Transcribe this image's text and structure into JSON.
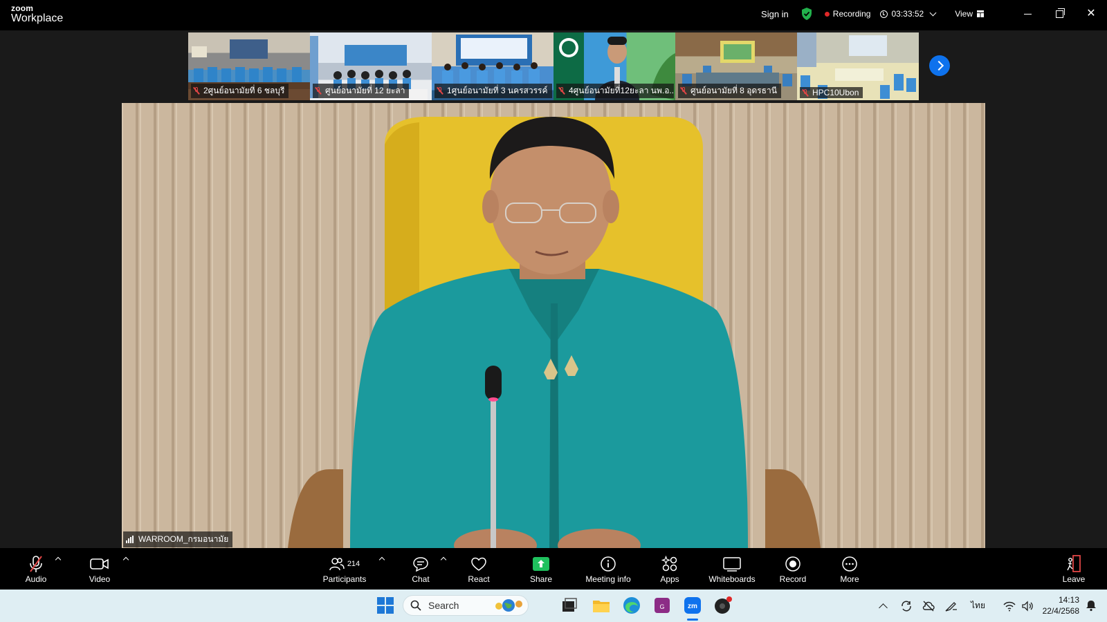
{
  "app": {
    "brand_small": "zoom",
    "brand_large": "Workplace"
  },
  "titlebar": {
    "sign_in": "Sign in",
    "recording": "Recording",
    "elapsed": "03:33:52",
    "view": "View",
    "icons": [
      "shield-check-icon",
      "clock-icon",
      "chevron-down-icon",
      "grid-icon",
      "minimize-icon",
      "restore-icon",
      "close-icon"
    ]
  },
  "thumbnails": [
    {
      "name": "2ศูนย์อนามัยที่ 6 ชลบุรี",
      "muted": true
    },
    {
      "name": "ศูนย์อนามัยที่ 12 ยะลา",
      "muted": true
    },
    {
      "name": "1ศูนย์อนามัยที่ 3 นครสวรรค์",
      "muted": true
    },
    {
      "name": "4ศูนย์อนามัยที่12ยะลา นพ.อ...",
      "muted": true
    },
    {
      "name": "ศูนย์อนามัยที่ 8 อุดรธานี",
      "muted": true
    },
    {
      "name": "HPC10Ubon",
      "muted": true
    }
  ],
  "main_video": {
    "speaker": "WARROOM_กรมอนามัย"
  },
  "toolbar": {
    "audio": "Audio",
    "video": "Video",
    "participants": "Participants",
    "participant_count": "214",
    "chat": "Chat",
    "react": "React",
    "share": "Share",
    "meeting_info": "Meeting info",
    "apps": "Apps",
    "whiteboards": "Whiteboards",
    "record": "Record",
    "more": "More",
    "leave": "Leave"
  },
  "taskbar": {
    "search_placeholder": "Search",
    "language": "ไทย",
    "time": "14:13",
    "date": "22/4/2568"
  },
  "colors": {
    "accent": "#0e72ed",
    "share_green": "#1fc15e",
    "muted_red": "#e04545",
    "shield_green": "#22b14c"
  }
}
